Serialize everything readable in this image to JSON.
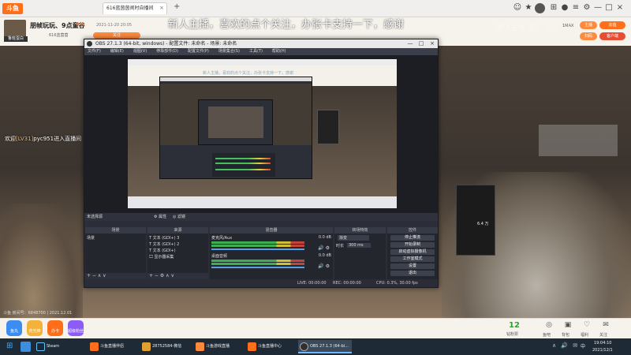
{
  "browser": {
    "logo": "斗鱼",
    "tab_title": "616蓝茵茵闹时自播间",
    "tab_close": "×",
    "new_tab": "+",
    "toolbar_icons": [
      "☺",
      "★",
      "⊞",
      "●",
      "≡",
      "⚙",
      "—",
      "□",
      "×"
    ]
  },
  "header": {
    "avatar_caption": "鲁班蛋白",
    "room_title": "朋帧玩玩、9点童谷",
    "heat": "♥ 6",
    "time": "2021-11-20 20:05",
    "sub_info": "616蓝茵茵",
    "follow": "关注",
    "right_label": "1MAX",
    "btn1": "主播",
    "btn2": "充值",
    "btn3": "扫码",
    "btn4": "客户端"
  },
  "stream": {
    "danmu_main": "新人主播，喜欢的点个关注，办张卡支持一下，感谢",
    "danmu_ghost": "新人主播  喜欢  支持一下",
    "welcome_prefix": "欢迎",
    "welcome_level": "[LV31]",
    "welcome_suffix": "pyc951进入直播间",
    "ticker": "斗鱼 房间号：6848700 | 2021.12.01",
    "views": "6.4 万"
  },
  "obs": {
    "title": "OBS 27.1.3 (64-bit, windows) - 配置文件: 未命名 - 场景: 未命名",
    "menu": [
      "文件(F)",
      "编辑(E)",
      "视图(V)",
      "停靠部件(D)",
      "配置文件(P)",
      "场景集合(S)",
      "工具(T)",
      "帮助(H)"
    ],
    "nested_danmu": "新人主播，喜欢的点个关注，办张卡支持一下，感谢",
    "status_source": "未选择源",
    "status_props": "⚙ 属性",
    "status_filters": "◎ 滤镜",
    "docks": {
      "scenes": {
        "title": "场景",
        "items": [
          "场景"
        ]
      },
      "sources": {
        "title": "来源",
        "items": [
          "T 文本 (GDI+) 3",
          "T 文本 (GDI+) 2",
          "T 文本 (GDI+)",
          "🖵 显示器采集"
        ]
      },
      "mixer": {
        "title": "混音器",
        "channels": [
          {
            "name": "麦克风/Aux",
            "db": "0.0 dB"
          },
          {
            "name": "桌面音频",
            "db": "0.0 dB"
          }
        ]
      },
      "transitions": {
        "title": "转场特效",
        "type": "渐变",
        "duration_label": "时长",
        "duration": "300 ms"
      },
      "controls": {
        "title": "控件",
        "buttons": [
          "停止推流",
          "开始录制",
          "启动虚拟摄像机",
          "工作室模式",
          "设置",
          "退出"
        ]
      }
    },
    "bottom_status": {
      "live": "LIVE: 00:00:00",
      "rec": "REC: 00:00:00",
      "cpu": "CPU: 0.3%, 30.00 fps"
    }
  },
  "giftbar": {
    "gifts": [
      "鱼丸",
      "荧光棒",
      "办卡",
      "超级粉丝"
    ],
    "count": "12",
    "count_label": "钻粉票",
    "tools": [
      {
        "icon": "◎",
        "label": "鱼吧"
      },
      {
        "icon": "▣",
        "label": "背包"
      },
      {
        "icon": "♡",
        "label": "福利"
      },
      {
        "icon": "✉",
        "label": "关注"
      }
    ]
  },
  "taskbar": {
    "apps": [
      {
        "label": "Steam",
        "color": "#1b2838"
      },
      {
        "label": "斗鱼直播伴侣",
        "color": "#ff6f1a"
      },
      {
        "label": "28752584-微信",
        "color": "#e0a030"
      },
      {
        "label": "斗鱼游戏直播",
        "color": "#ff8a3d"
      },
      {
        "label": "斗鱼直播中心",
        "color": "#ff6f1a"
      },
      {
        "label": "OBS 27.1.3 (64-bi...",
        "color": "#302e31"
      }
    ],
    "lang": "中",
    "tray": "∧ 🔊 ✉",
    "time": "19:04:10",
    "date": "2021/12/1"
  },
  "colors": {
    "accent": "#ff6f1a",
    "obs_bg": "#2b2e38",
    "taskbar": "#1e2a36"
  }
}
